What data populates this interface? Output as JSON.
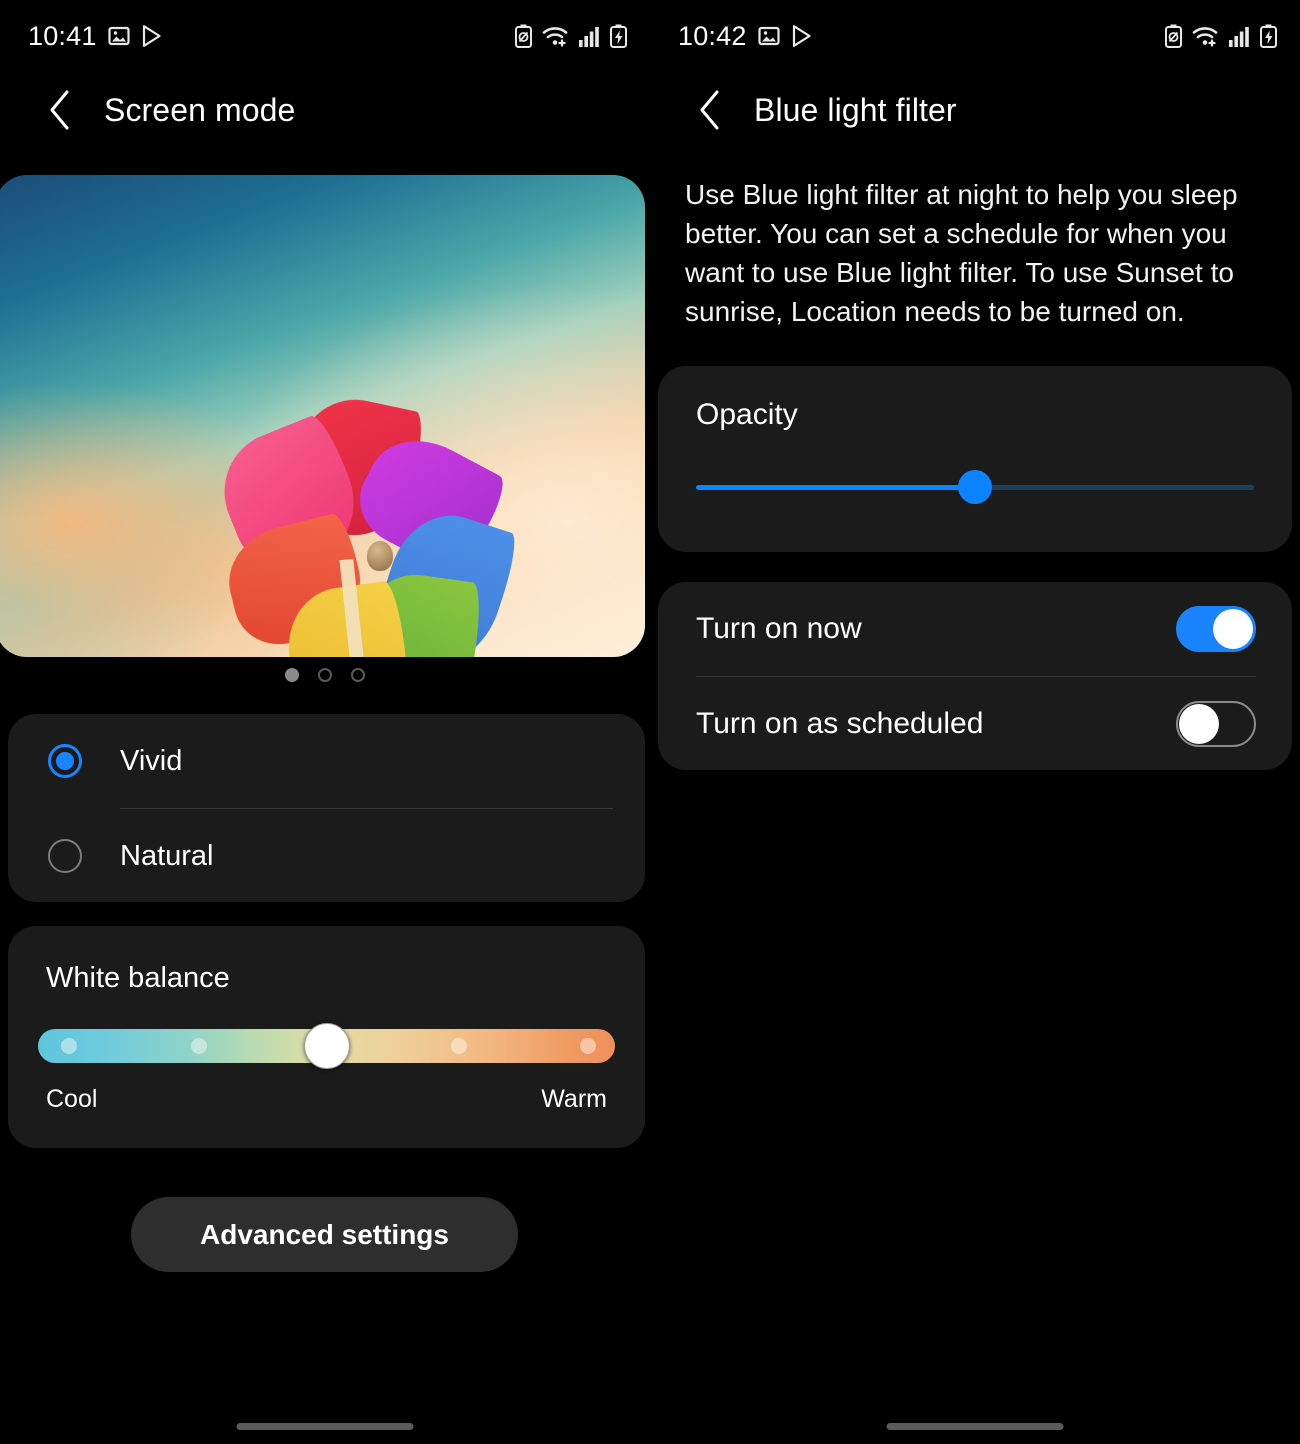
{
  "left_panel": {
    "status_bar": {
      "time": "10:41",
      "left_icons": [
        "image-icon",
        "play-store-icon"
      ],
      "right_icons": [
        "power-saving-icon",
        "wifi-icon",
        "signal-icon",
        "battery-charging-icon"
      ]
    },
    "header": {
      "back_icon": "chevron-left-icon",
      "title": "Screen mode"
    },
    "preview": {
      "name": "screen-mode-preview-image",
      "alt": "Colorful pinwheel against a sunset sky"
    },
    "page_indicator": {
      "total": 3,
      "active_index": 0
    },
    "mode_options": [
      {
        "label": "Vivid",
        "selected": true
      },
      {
        "label": "Natural",
        "selected": false
      }
    ],
    "white_balance": {
      "title": "White balance",
      "min_label": "Cool",
      "max_label": "Warm",
      "value_percent": 50,
      "tick_positions": [
        5,
        28,
        50,
        72,
        95
      ]
    },
    "advanced_button": "Advanced settings"
  },
  "right_panel": {
    "status_bar": {
      "time": "10:42",
      "left_icons": [
        "image-icon",
        "play-store-icon"
      ],
      "right_icons": [
        "power-saving-icon",
        "wifi-icon",
        "signal-icon",
        "battery-charging-icon"
      ]
    },
    "header": {
      "back_icon": "chevron-left-icon",
      "title": "Blue light filter"
    },
    "description": "Use Blue light filter at night to help you sleep better. You can set a schedule for when you want to use Blue light filter. To use Sunset to sunrise, Location needs to be turned on.",
    "opacity": {
      "title": "Opacity",
      "value_percent": 50
    },
    "toggles": [
      {
        "label": "Turn on now",
        "on": true
      },
      {
        "label": "Turn on as scheduled",
        "on": false
      }
    ]
  },
  "colors": {
    "background": "#000000",
    "card": "#1b1b1b",
    "accent_blue": "#1a84ff",
    "slider_blue": "#0d84ff",
    "slider_track_dim": "#1d3f5e",
    "button_gray": "#2e2e2e",
    "text_primary": "#ffffff",
    "divider": "#3a3a3a"
  }
}
